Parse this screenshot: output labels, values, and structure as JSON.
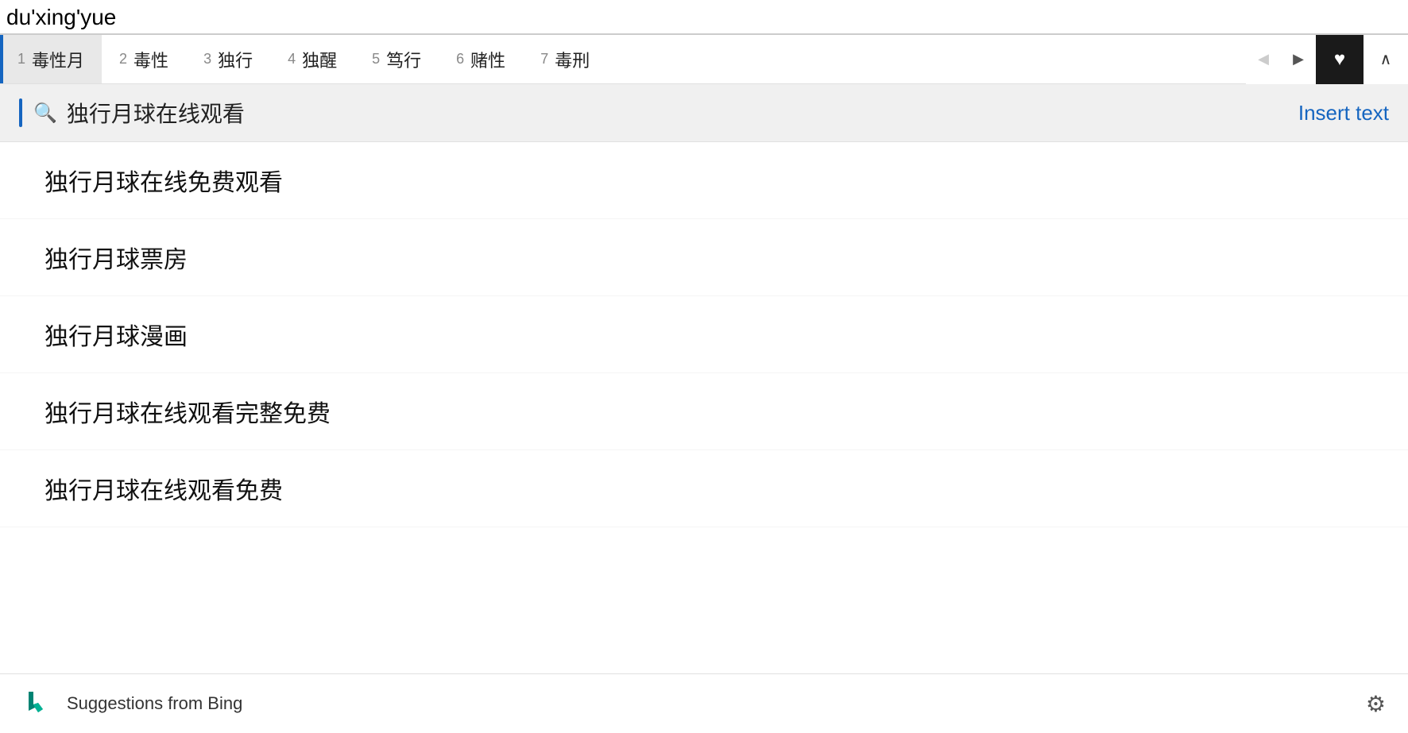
{
  "topInput": {
    "value": "du'xing'yue"
  },
  "candidateBar": {
    "items": [
      {
        "num": "1",
        "text": "毒性月",
        "active": true
      },
      {
        "num": "2",
        "text": "毒性"
      },
      {
        "num": "3",
        "text": "独行"
      },
      {
        "num": "4",
        "text": "独醒"
      },
      {
        "num": "5",
        "text": "笃行"
      },
      {
        "num": "6",
        "text": "赌性"
      },
      {
        "num": "7",
        "text": "毒刑"
      }
    ],
    "prevDisabled": true,
    "nextDisabled": false
  },
  "searchBar": {
    "text": "独行月球在线观看",
    "insertTextLabel": "Insert text"
  },
  "suggestions": [
    {
      "text": "独行月球在线免费观看"
    },
    {
      "text": "独行月球票房"
    },
    {
      "text": "独行月球漫画"
    },
    {
      "text": "独行月球在线观看完整免费"
    },
    {
      "text": "独行月球在线观看免费"
    }
  ],
  "footer": {
    "logoLabel": "bing-logo",
    "text": "Suggestions from Bing",
    "gearLabel": "settings"
  },
  "icons": {
    "search": "🔍",
    "heart": "♥",
    "prevArrow": "◀",
    "nextArrow": "▶",
    "collapseArrow": "∧",
    "gear": "⚙"
  }
}
